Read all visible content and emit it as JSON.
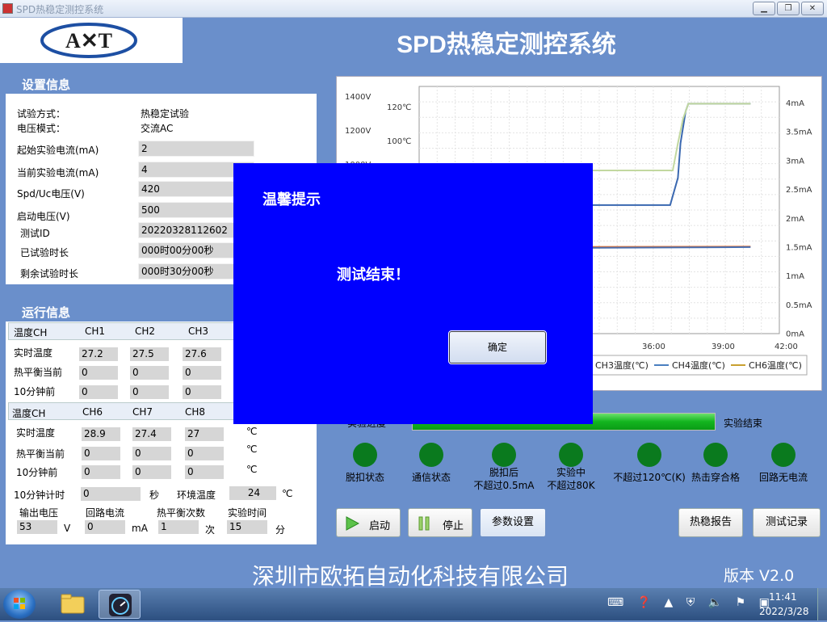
{
  "window": {
    "title": "SPD热稳定测控系统"
  },
  "header": {
    "logo_text": "A✕T",
    "title": "SPD热稳定测控系统"
  },
  "settings": {
    "heading": "设置信息",
    "test_mode_label": "试验方式：",
    "test_mode_value": "热稳定试验",
    "voltage_mode_label": "电压模式：",
    "voltage_mode_value": "交流AC",
    "start_current_label": "起始实验电流(mA)",
    "start_current_value": "2",
    "current_current_label": "当前实验电流(mA)",
    "current_current_value": "4",
    "spd_uc_label": "Spd/Uc电压(V)",
    "spd_uc_value": "420",
    "start_voltage_label": "启动电压(V)",
    "start_voltage_value": "500",
    "test_id_label": "测试ID",
    "test_id_value": "20220328112602",
    "elapsed_label": "已试验时长",
    "elapsed_value": "000时00分00秒",
    "remaining_label": "剩余试验时长",
    "remaining_value": "000时30分00秒"
  },
  "runtime": {
    "heading": "运行信息",
    "group1": {
      "header_label": "温度CH",
      "channels": [
        "CH1",
        "CH2",
        "CH3"
      ],
      "rows": [
        {
          "label": "实时温度",
          "values": [
            "27.2",
            "27.5",
            "27.6"
          ]
        },
        {
          "label": "热平衡当前",
          "values": [
            "0",
            "0",
            "0"
          ]
        },
        {
          "label": "10分钟前",
          "values": [
            "0",
            "0",
            "0"
          ]
        }
      ]
    },
    "group2": {
      "header_label": "温度CH",
      "channels": [
        "CH6",
        "CH7",
        "CH8"
      ],
      "rows": [
        {
          "label": "实时温度",
          "values": [
            "28.9",
            "27.4",
            "27"
          ],
          "unit": "℃"
        },
        {
          "label": "热平衡当前",
          "values": [
            "0",
            "0",
            "0"
          ],
          "unit": "℃"
        },
        {
          "label": "10分钟前",
          "values": [
            "0",
            "0",
            "0"
          ],
          "unit": "℃"
        }
      ]
    },
    "timer_label": "10分钟计时",
    "timer_value": "0",
    "timer_unit": "秒",
    "ambient_label": "环境温度",
    "ambient_value": "24",
    "ambient_unit": "℃",
    "output_voltage_label": "输出电压",
    "output_voltage_value": "53",
    "output_voltage_unit": "V",
    "loop_current_label": "回路电流",
    "loop_current_value": "0",
    "loop_current_unit": "mA",
    "balance_count_label": "热平衡次数",
    "balance_count_value": "1",
    "balance_count_unit": "次",
    "test_time_label": "实验时间",
    "test_time_value": "15",
    "test_time_unit": "分"
  },
  "chart_data": {
    "type": "line",
    "voltage_ticks": [
      "1400V",
      "1200V",
      "1000V"
    ],
    "temp_ticks": [
      "120℃",
      "100℃"
    ],
    "current_ticks": [
      "4mA",
      "3.5mA",
      "3mA",
      "2.5mA",
      "2mA",
      "1.5mA",
      "1mA",
      "0.5mA",
      "0mA"
    ],
    "x_ticks": [
      "36:00",
      "39:00",
      "42:00"
    ],
    "legend": [
      {
        "name": "CH3温度(℃)",
        "color": "#9ab0cc"
      },
      {
        "name": "CH4温度(℃)",
        "color": "#4a7fc0"
      },
      {
        "name": "CH6温度(℃)",
        "color": "#c8a030"
      }
    ],
    "series": [
      {
        "name": "CH4温度(℃)",
        "color": "#3a68b0",
        "points": [
          [
            0,
            0.43
          ],
          [
            0.69,
            0.43
          ],
          [
            0.72,
            0.32
          ],
          [
            0.73,
            0.18
          ],
          [
            0.75,
            0.05
          ],
          [
            0.76,
            0.02
          ],
          [
            1.0,
            0.02
          ]
        ]
      },
      {
        "name": "CH6温度(℃)",
        "color": "#c2d8a0",
        "points": [
          [
            0,
            0.29
          ],
          [
            0.7,
            0.29
          ],
          [
            0.72,
            0.18
          ],
          [
            0.74,
            0.08
          ],
          [
            0.76,
            0.02
          ],
          [
            1.0,
            0.02
          ]
        ]
      },
      {
        "name": "CH3温度(℃)",
        "color": "#e07030",
        "points": [
          [
            0,
            0.6
          ],
          [
            1.0,
            0.598
          ]
        ]
      },
      {
        "name": "CH3温度(℃)",
        "color": "#4a6fb0",
        "points": [
          [
            0,
            0.605
          ],
          [
            1.0,
            0.6
          ]
        ]
      }
    ]
  },
  "progress": {
    "label": "实验进度",
    "status": "实验结束",
    "fill_fraction": 1.0
  },
  "indicators": [
    {
      "label": "脱扣状态"
    },
    {
      "label": "通信状态"
    },
    {
      "label": "脱扣后\n不超过0.5mA"
    },
    {
      "label": "实验中\n不超过80K"
    },
    {
      "label": "不超过120℃(K)"
    },
    {
      "label": "热击穿合格"
    },
    {
      "label": "回路无电流"
    }
  ],
  "buttons": {
    "start": "启动",
    "stop": "停止",
    "params": "参数设置",
    "report": "热稳报告",
    "records": "测试记录"
  },
  "dialog": {
    "title": "温馨提示",
    "message": "测试结束！",
    "ok": "确定"
  },
  "footer": {
    "company": "深圳市欧拓自动化科技有限公司",
    "version": "版本 V2.0"
  },
  "taskbar": {
    "time": "11:41",
    "date": "2022/3/28"
  },
  "colors": {
    "accent": "#6a8fcb",
    "dialog_bg": "#0000ff",
    "indicator": "#0a7a1e"
  }
}
